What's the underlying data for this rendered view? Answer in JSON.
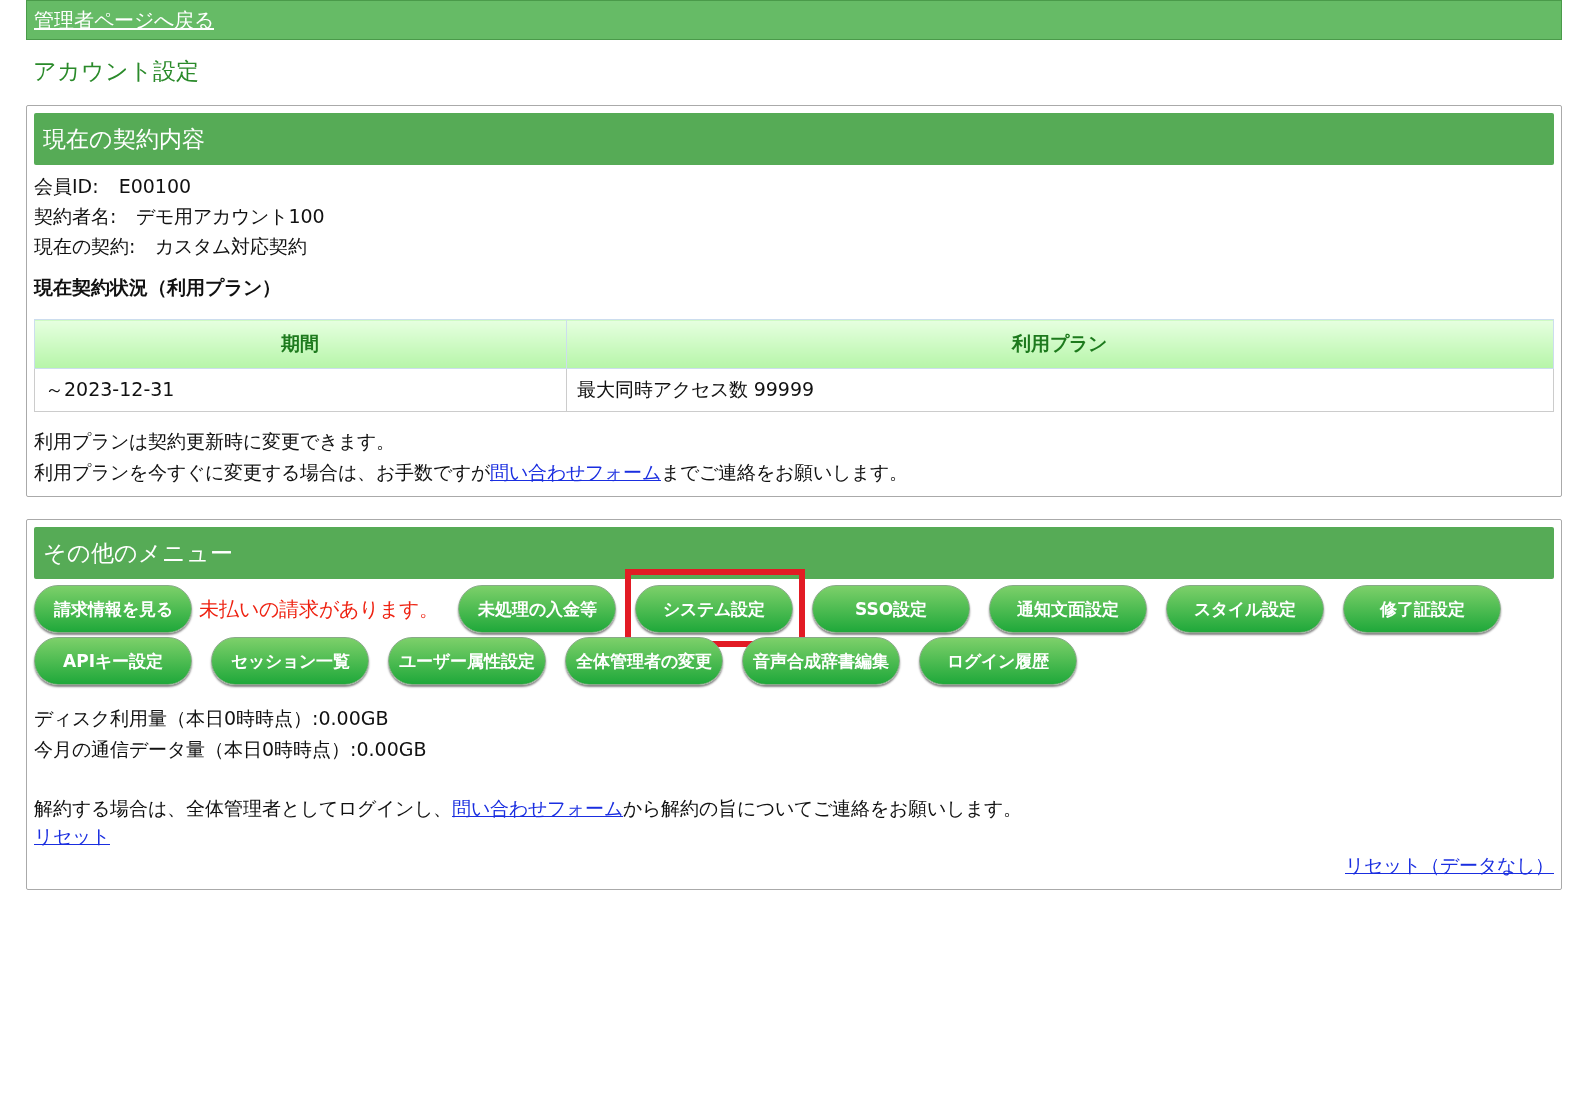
{
  "back_link": "管理者ページへ戻る",
  "page_title": "アカウント設定",
  "contract": {
    "heading": "現在の契約内容",
    "fields": [
      {
        "label": "会員ID:",
        "value": "E00100"
      },
      {
        "label": "契約者名:",
        "value": "デモ用アカウント100"
      },
      {
        "label": "現在の契約:",
        "value": "カスタム対応契約"
      }
    ],
    "status_heading": "現在契約状況（利用プラン）",
    "table": {
      "columns": [
        "期間",
        "利用プラン"
      ],
      "rows": [
        [
          "～2023-12-31",
          "最大同時アクセス数 99999"
        ]
      ]
    },
    "note_lines": [
      {
        "before": "利用プランは契約更新時に変更できます。"
      },
      {
        "before": "利用プランを今すぐに変更する場合は、お手数ですが",
        "link": "問い合わせフォーム",
        "after": "までご連絡をお願いします。"
      }
    ]
  },
  "menu": {
    "heading": "その他のメニュー",
    "items": [
      {
        "kind": "button",
        "label": "請求情報を見る",
        "highlighted": false
      },
      {
        "kind": "notice",
        "label": "未払いの請求があります。"
      },
      {
        "kind": "button",
        "label": "未処理の入金等",
        "highlighted": false
      },
      {
        "kind": "button",
        "label": "システム設定",
        "highlighted": true
      },
      {
        "kind": "button",
        "label": "SSO設定",
        "highlighted": false
      },
      {
        "kind": "button",
        "label": "通知文面設定",
        "highlighted": false
      },
      {
        "kind": "button",
        "label": "スタイル設定",
        "highlighted": false
      },
      {
        "kind": "button",
        "label": "修了証設定",
        "highlighted": false
      },
      {
        "kind": "button",
        "label": "APIキー設定",
        "highlighted": false
      },
      {
        "kind": "button",
        "label": "セッション一覧",
        "highlighted": false
      },
      {
        "kind": "button",
        "label": "ユーザー属性設定",
        "highlighted": false
      },
      {
        "kind": "button",
        "label": "全体管理者の変更",
        "highlighted": false
      },
      {
        "kind": "button",
        "label": "音声合成辞書編集",
        "highlighted": false
      },
      {
        "kind": "button",
        "label": "ログイン履歴",
        "highlighted": false
      }
    ],
    "usage": [
      "ディスク利用量（本日0時時点）:0.00GB",
      "今月の通信データ量（本日0時時点）:0.00GB"
    ],
    "cancel_note": {
      "before": "解約する場合は、全体管理者としてログインし、",
      "link": "問い合わせフォーム",
      "after": "から解約の旨についてご連絡をお願いします。"
    },
    "reset_link": "リセット",
    "reset_nodata_link": "リセット（データなし）"
  }
}
